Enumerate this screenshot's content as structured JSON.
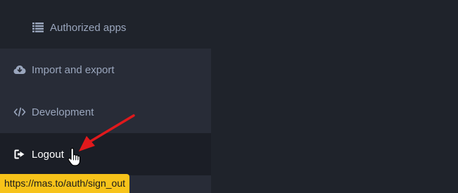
{
  "sidebar": {
    "items": [
      {
        "label": "Authorized apps",
        "icon": "list-icon"
      },
      {
        "label": "Import and export",
        "icon": "cloud-download-icon"
      },
      {
        "label": "Development",
        "icon": "code-icon"
      },
      {
        "label": "Logout",
        "icon": "sign-out-icon"
      }
    ]
  },
  "status_bar": {
    "url": "https://mas.to/auth/sign_out"
  },
  "colors": {
    "background": "#1f232b",
    "sidebar_item": "#282c37",
    "active_item": "#1b1e26",
    "text": "#9aa6bd",
    "status_bar": "#f7c31a",
    "annotation_arrow": "#e0191c"
  }
}
